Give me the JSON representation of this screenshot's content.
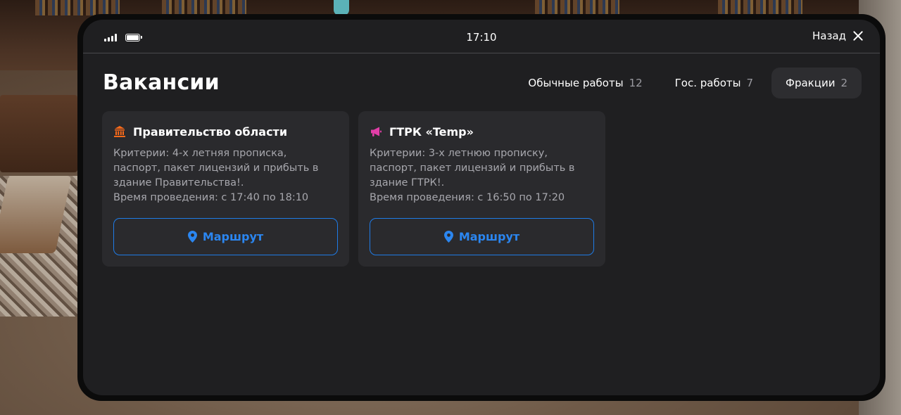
{
  "status_bar": {
    "time": "17:10",
    "back_label": "Назад"
  },
  "page": {
    "title": "Вакансии"
  },
  "tabs": [
    {
      "label": "Обычные работы",
      "count": "12",
      "active": false
    },
    {
      "label": "Гос. работы",
      "count": "7",
      "active": false
    },
    {
      "label": "Фракции",
      "count": "2",
      "active": true
    }
  ],
  "cards": [
    {
      "icon": "government-building-icon",
      "icon_color": "#ff6b1a",
      "title": "Правительство области",
      "description": "Критерии: 4-х летняя прописка,\nпаспорт, пакет лицензий и прибыть в\nздание Правительства!.\nВремя проведения: с 17:40 по 18:10",
      "button_label": "Маршрут"
    },
    {
      "icon": "megaphone-icon",
      "icon_color": "#e23ea8",
      "title": "ГТРК «Temp»",
      "description": "Критерии: 3-х летнюю прописку,\nпаспорт, пакет лицензий и прибыть в\nздание ГТРК!.\nВремя проведения: с 16:50 по 17:20",
      "button_label": "Маршрут"
    }
  ],
  "colors": {
    "accent": "#1f7be6",
    "panel": "#1f1f21",
    "card": "#2a2a2d"
  }
}
